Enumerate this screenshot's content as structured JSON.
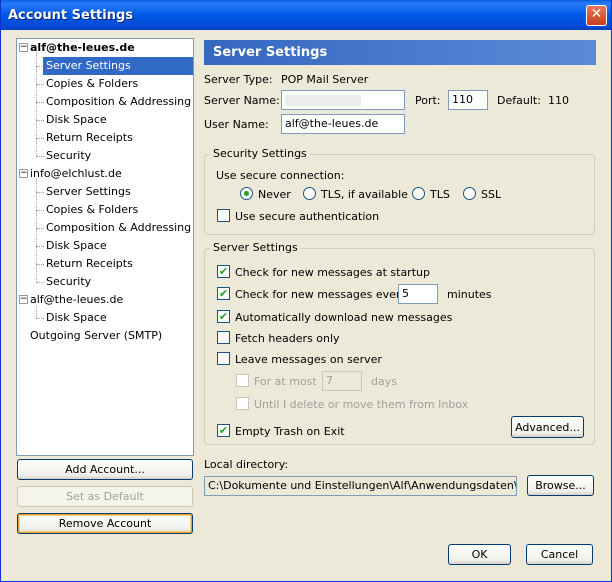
{
  "window": {
    "title": "Account Settings",
    "close_glyph": "✕"
  },
  "tree": {
    "items": [
      {
        "label": "alf@the-leues.de",
        "level": 0,
        "bold": true,
        "expanded": true
      },
      {
        "label": "Server Settings",
        "level": 1,
        "selected": true
      },
      {
        "label": "Copies & Folders",
        "level": 1
      },
      {
        "label": "Composition & Addressing",
        "level": 1
      },
      {
        "label": "Disk Space",
        "level": 1
      },
      {
        "label": "Return Receipts",
        "level": 1
      },
      {
        "label": "Security",
        "level": 1
      },
      {
        "label": "info@elchlust.de",
        "level": 0,
        "expanded": true
      },
      {
        "label": "Server Settings",
        "level": 1
      },
      {
        "label": "Copies & Folders",
        "level": 1
      },
      {
        "label": "Composition & Addressing",
        "level": 1
      },
      {
        "label": "Disk Space",
        "level": 1
      },
      {
        "label": "Return Receipts",
        "level": 1
      },
      {
        "label": "Security",
        "level": 1
      },
      {
        "label": "alf@the-leues.de",
        "level": 0,
        "expanded": true
      },
      {
        "label": "Disk Space",
        "level": 1
      },
      {
        "label": "Outgoing Server (SMTP)",
        "level": 0,
        "leaf": true
      }
    ]
  },
  "left_buttons": {
    "add_account": "Add Account...",
    "set_default": "Set as Default",
    "remove_account": "Remove Account"
  },
  "panel": {
    "header": "Server Settings",
    "server_type_label": "Server Type:",
    "server_type_value": "POP Mail Server",
    "server_name_label": "Server Name:",
    "server_name_value": "",
    "port_label": "Port:",
    "port_value": "110",
    "default_label": "Default:",
    "default_value": "110",
    "user_name_label": "User Name:",
    "user_name_value": "alf@the-leues.de"
  },
  "security": {
    "legend": "Security Settings",
    "connection_label": "Use secure connection:",
    "options": [
      "Never",
      "TLS, if available",
      "TLS",
      "SSL"
    ],
    "selected": "Never",
    "secure_auth_label": "Use secure authentication",
    "secure_auth_checked": false
  },
  "server_settings": {
    "legend": "Server Settings",
    "check_startup_label": "Check for new messages at startup",
    "check_startup_checked": true,
    "check_every_label": "Check for new messages every",
    "check_every_checked": true,
    "check_every_value": "5",
    "minutes_label": "minutes",
    "auto_download_label": "Automatically download new messages",
    "auto_download_checked": true,
    "fetch_headers_label": "Fetch headers only",
    "fetch_headers_checked": false,
    "leave_on_server_label": "Leave messages on server",
    "leave_on_server_checked": false,
    "for_at_most_label": "For at most",
    "for_at_most_value": "7",
    "days_label": "days",
    "until_delete_label": "Until I delete or move them from Inbox",
    "advanced_label": "Advanced...",
    "empty_trash_label": "Empty Trash on Exit",
    "empty_trash_checked": true
  },
  "local_directory": {
    "label": "Local directory:",
    "value": "C:\\Dokumente und Einstellungen\\Alf\\Anwendungsdaten\\Thunde",
    "browse_label": "Browse..."
  },
  "footer": {
    "ok_label": "OK",
    "cancel_label": "Cancel"
  },
  "colors": {
    "selection": "#316ac5",
    "title_bar": "#0058e6",
    "check_mark": "#21a121"
  },
  "icons": {
    "check": "checkmark-icon",
    "close": "close-icon",
    "expander": "minus-expander-icon"
  }
}
